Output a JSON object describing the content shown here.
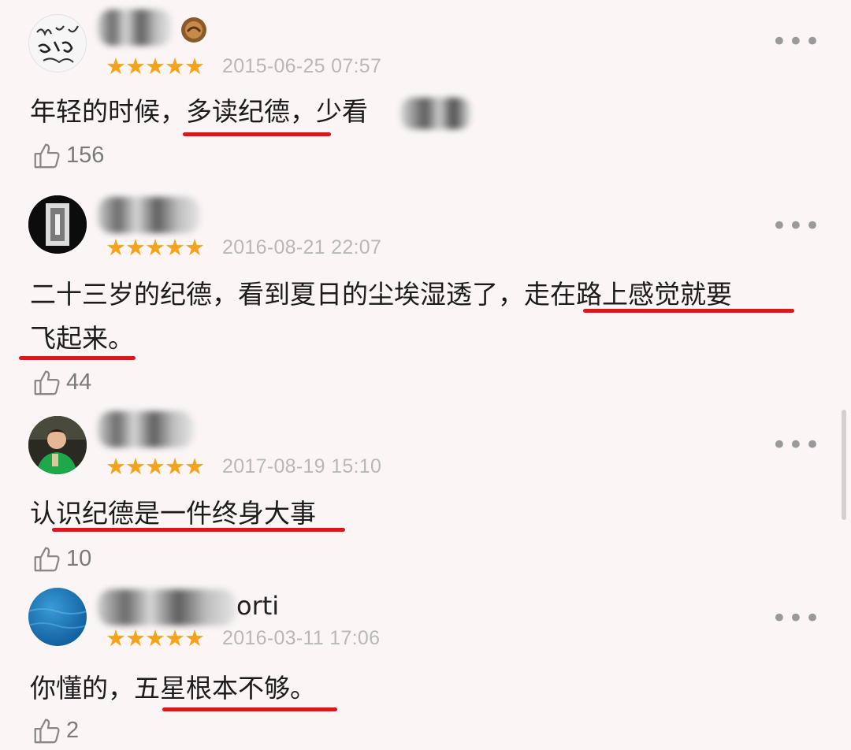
{
  "reviews": [
    {
      "username_visible": "",
      "stars": "★★★★★",
      "date": "2015-06-25 07:57",
      "text_before": "年轻的时候，",
      "text_highlight": "多读纪德",
      "text_after": "，少看",
      "likes": "156"
    },
    {
      "username_visible": "",
      "stars": "★★★★★",
      "date": "2016-08-21 22:07",
      "text_line1_plain": "二十三岁的纪德，看到夏日的尘埃湿透了，",
      "text_line1_highlight": "走在路上感觉就要",
      "text_line2_highlight": "飞起来。",
      "likes": "44"
    },
    {
      "username_visible": "",
      "stars": "★★★★★",
      "date": "2017-08-19 15:10",
      "text_highlight": "认识纪德是一件终身大事",
      "likes": "10"
    },
    {
      "username_visible": "orti",
      "stars": "★★★★★",
      "date": "2016-03-11 17:06",
      "text_before": "你懂的，",
      "text_highlight": "五星根本不够。",
      "likes": "2"
    }
  ],
  "more_label": "•••",
  "colors": {
    "star": "#f7a21b",
    "underline": "#e0141a",
    "date": "#b8b8b8",
    "background": "#fbf6f5"
  },
  "icons": {
    "like": "thumbs-up-icon",
    "more": "more-dots-icon",
    "badge": "medal-badge-icon"
  }
}
